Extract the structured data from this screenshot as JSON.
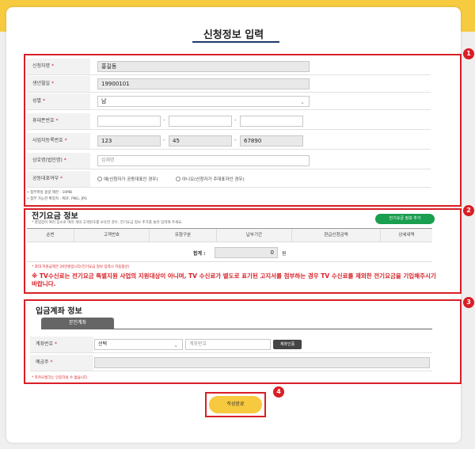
{
  "page": {
    "title": "신청정보 입력"
  },
  "badges": [
    "1",
    "2",
    "3",
    "4"
  ],
  "applicant": {
    "name": {
      "label": "신청자명",
      "req": "*",
      "value": "홍길동"
    },
    "birth": {
      "label": "생년월일",
      "req": "*",
      "value": "19900101"
    },
    "gender": {
      "label": "성별",
      "req": "*",
      "value": "남"
    },
    "phone": {
      "label": "휴대폰번호",
      "req": "*"
    },
    "bizno": {
      "label": "사업자등록번호",
      "req": "*",
      "v1": "123",
      "v2": "45",
      "v3": "67890"
    },
    "company": {
      "label": "상호명(법인명)",
      "req": "*",
      "placeholder": "업체명"
    },
    "rep": {
      "label": "공동대표여부",
      "req": "*",
      "opt_yes": "예(신청자가 공동대표인 경우)",
      "opt_no": "아니오(신청자가 주대표자인 경우)"
    },
    "notes": [
      "• 첨부파일 용량 제한 : 10MB",
      "• 첨부 가능한 확장자 : PDF, PNG, JPG"
    ]
  },
  "electricity": {
    "title": "전기요금 정보",
    "desc": "* 영업장이 여러 장소로 여러 개의 고객번호를 보유한 경우, 전기요금 정보 추가를 눌러 입력해 주세요.",
    "add_button": "전기요금 정보 추가",
    "columns": [
      "순번",
      "고객번호",
      "유형구분",
      "납부기간",
      "환급신청금액",
      "상세내역"
    ],
    "total_label": "합계 :",
    "total_value": "0",
    "total_unit": "원",
    "note_small": "* 최대 지원금액은 20만원입니다(전기요금 정보 입력시 자동합산)",
    "note_big": "※ TV수신료는 전기요금 특별지원 사업의 지원대상이 아니며, TV 수신료가 별도로 표기된 고지서를 첨부하는 경우 TV 수신료를 제외한 전기요금을 기입해주시기 바랍니다."
  },
  "account": {
    "title": "입금계좌 정보",
    "tab": "본인계좌",
    "bank": {
      "label": "계좌번호",
      "req": "*",
      "value": "선택",
      "placeholder": "계좌번호",
      "verify": "계좌인증"
    },
    "holder": {
      "label": "예금주",
      "req": "*"
    },
    "note": "* 카카오뱅크는 인증하실 수 없습니다."
  },
  "submit": "작성완료",
  "colors": {
    "accent_yellow": "#f6cb3f",
    "highlight_red": "#d81f26",
    "green": "#1a9e50"
  }
}
